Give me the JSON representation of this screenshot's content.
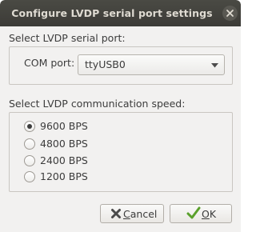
{
  "window": {
    "title": "Configure LVDP serial port settings"
  },
  "port_section": {
    "label": "Select LVDP serial port:",
    "com_label": "COM port:",
    "selected_port": "ttyUSB0"
  },
  "speed_section": {
    "label": "Select LVDP communication speed:",
    "options": [
      {
        "label": "9600 BPS",
        "selected": true
      },
      {
        "label": "4800 BPS",
        "selected": false
      },
      {
        "label": "2400 BPS",
        "selected": false
      },
      {
        "label": "1200 BPS",
        "selected": false
      }
    ]
  },
  "buttons": {
    "cancel_first": "C",
    "cancel_rest": "ancel",
    "ok_first": "O",
    "ok_rest": "K"
  },
  "icons": {
    "close": "close-icon",
    "dropdown": "chevron-down-icon",
    "cancel": "cancel-x-icon",
    "ok": "checkmark-icon"
  },
  "colors": {
    "titlebar": "#3c3b37",
    "dialog_bg": "#f2f1f0",
    "ok_check": "#5aa02c"
  }
}
